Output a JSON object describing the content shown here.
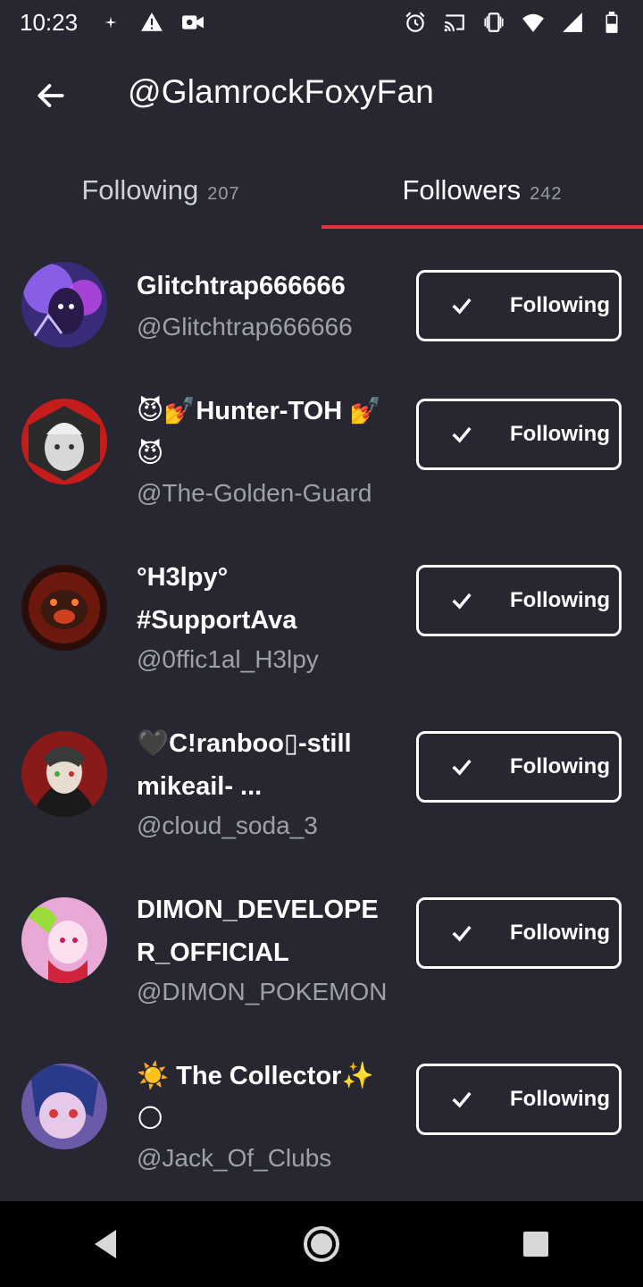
{
  "status_bar": {
    "time": "10:23",
    "left_icons": [
      "sparkle-icon",
      "warning-icon",
      "video-camera-icon"
    ],
    "right_icons": [
      "alarm-icon",
      "cast-icon",
      "vibrate-icon",
      "wifi-icon",
      "signal-icon",
      "battery-icon"
    ]
  },
  "header": {
    "title": "@GlamrockFoxyFan",
    "back_icon": "arrow-back-icon"
  },
  "tabs": [
    {
      "label": "Following",
      "count": "207",
      "active": false
    },
    {
      "label": "Followers",
      "count": "242",
      "active": true
    }
  ],
  "colors": {
    "background": "#262731",
    "accent": "#e0353d",
    "handle_text": "#9fa0a8"
  },
  "users": [
    {
      "name": "Glitchtrap666666",
      "handle": "@Glitchtrap666666",
      "button": "Following"
    },
    {
      "name": "😈💅Hunter-TOH 💅😈",
      "handle": "@The-Golden-Guard",
      "button": "Following"
    },
    {
      "name": "°H3lpy° #SupportAva",
      "handle": "@0ffic1al_H3lpy",
      "button": "Following"
    },
    {
      "name": "🖤C!ranboo▯-still mikeail- ...",
      "handle": "@cloud_soda_3",
      "button": "Following"
    },
    {
      "name": "DIMON_DEVELOPER_OFFICIAL",
      "handle": "@DIMON_POKEMON",
      "button": "Following"
    },
    {
      "name": "☀️ The Collector✨🌕",
      "handle": "@Jack_Of_Clubs",
      "button": "Following"
    }
  ],
  "nav_bar": {
    "buttons": [
      "back-triangle-icon",
      "home-circle-icon",
      "recents-square-icon"
    ]
  }
}
